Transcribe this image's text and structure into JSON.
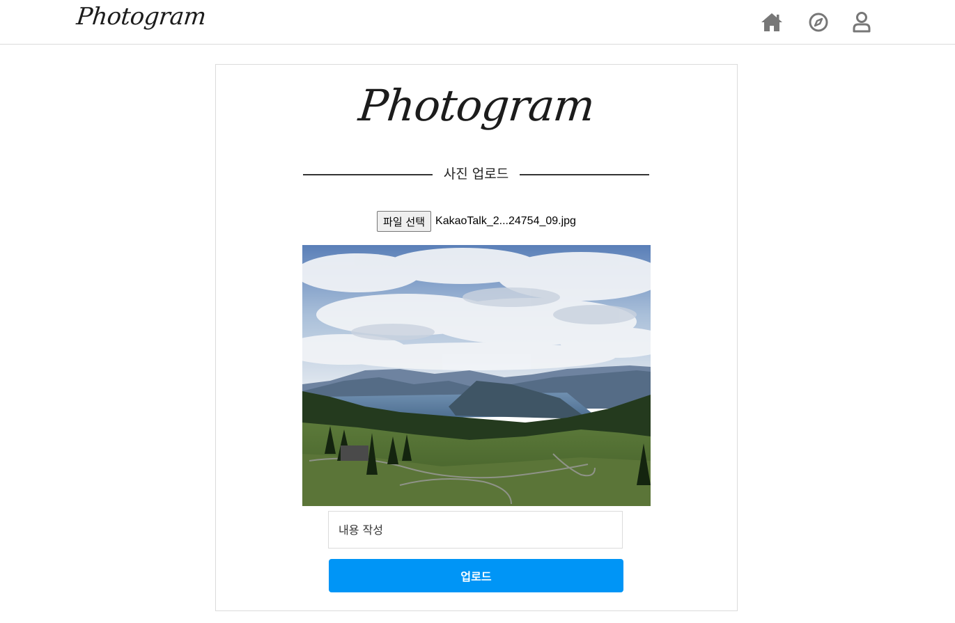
{
  "header": {
    "logo_text": "Photogram",
    "nav": [
      {
        "icon": "home-icon"
      },
      {
        "icon": "compass-icon"
      },
      {
        "icon": "user-icon"
      }
    ],
    "icon_color": "#777777"
  },
  "upload_card": {
    "logo_text": "Photogram",
    "section_title": "사진 업로드",
    "file_button_label": "파일 선택",
    "file_name": "KakaoTalk_2...24754_09.jpg",
    "caption_placeholder": "내용 작성",
    "caption_value": "",
    "upload_button_label": "업로드",
    "accent_color": "#0095f6"
  }
}
